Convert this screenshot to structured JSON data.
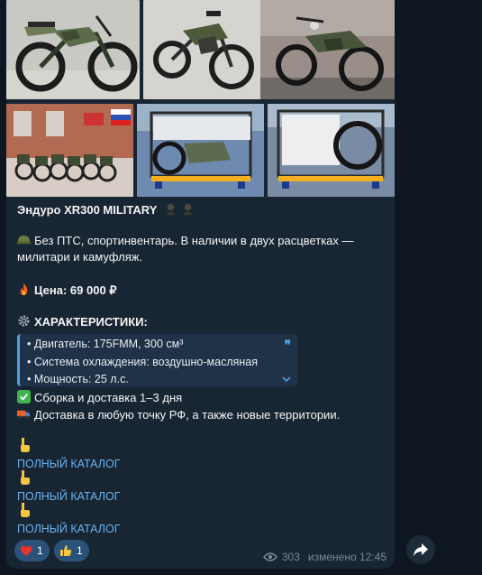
{
  "post": {
    "title": "Эндуро XR300 MILITARY",
    "desc": "Без ПТС, спортинвентарь. В наличии в двух расцветках — милитари и камуфляж.",
    "price": "Цена: 69 000 ₽",
    "specs_heading": "ХАРАКТЕРИСТИКИ:",
    "specs": [
      "• Двигатель: 175FMM, 300 см³",
      "• Система охлаждения: воздушно-масляная",
      "• Мощность: 25 л.с."
    ],
    "assembly": "Сборка и доставка 1–3 дня",
    "delivery": "Доставка в любую точку РФ, а также новые территории.",
    "catalog_links": [
      "ПОЛНЫЙ КАТАЛОГ",
      "ПОЛНЫЙ КАТАЛОГ",
      "ПОЛНЫЙ КАТАЛОГ"
    ]
  },
  "reactions": [
    {
      "icon": "heart-icon",
      "count": "1"
    },
    {
      "icon": "thumbs-up-icon",
      "count": "1"
    }
  ],
  "meta": {
    "views": "303",
    "edited": "изменено 12:45"
  },
  "colors": {
    "background": "#0e1621",
    "bubble": "#182533",
    "link": "#6cb2ef",
    "quote_accent": "#4fa2e6",
    "reaction_bg": "#2b5278"
  }
}
